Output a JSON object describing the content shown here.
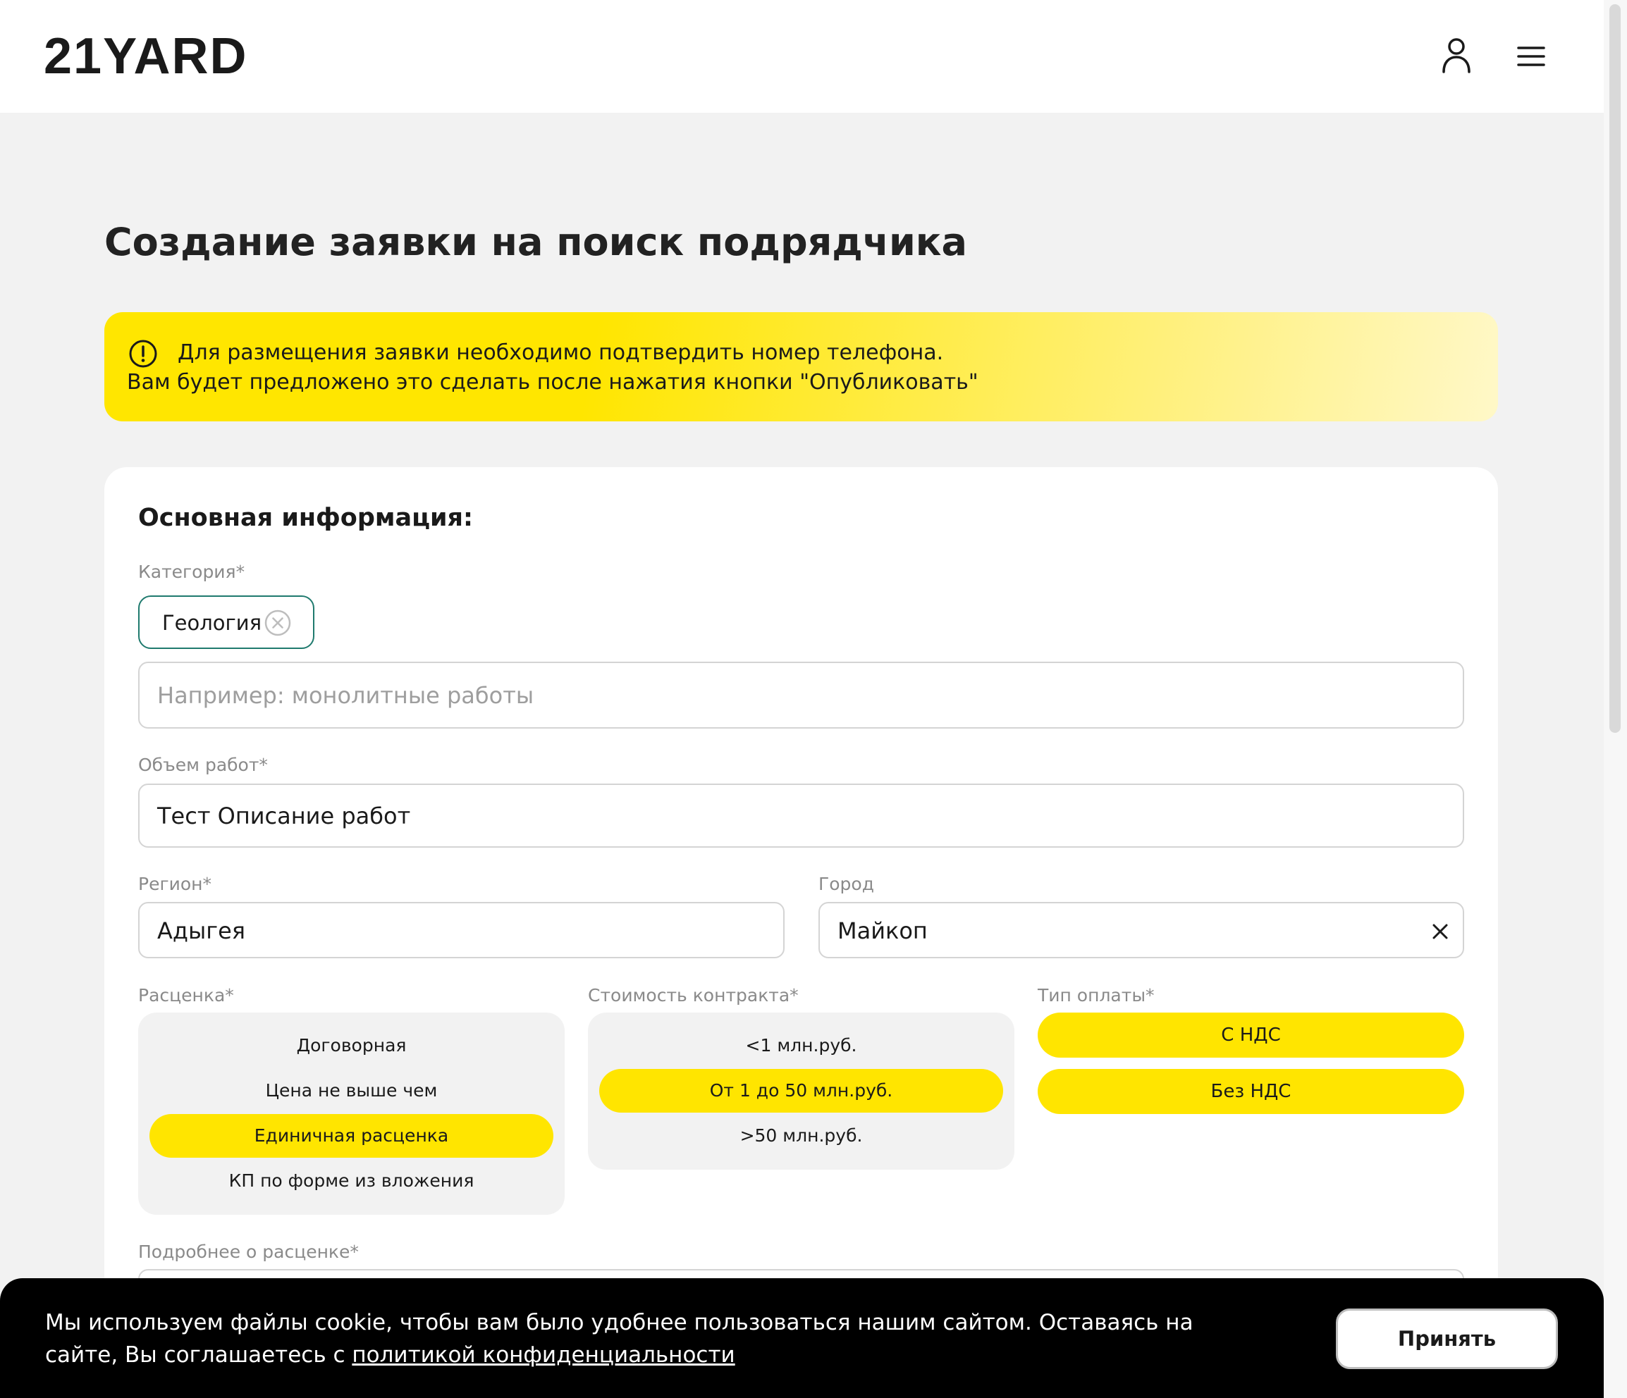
{
  "header": {
    "logo": "21YARD",
    "user_icon": "user-icon",
    "menu_icon": "hamburger-menu-icon"
  },
  "page": {
    "title": "Создание заявки на поиск подрядчика"
  },
  "notice": {
    "icon": "exclamation-circle-icon",
    "line1": "Для размещения заявки необходимо подтвердить номер телефона.",
    "line2": "Вам будет предложено это сделать после нажатия кнопки \"Опубликовать\""
  },
  "form": {
    "section_title": "Основная информация:",
    "category": {
      "label": "Категория*",
      "chip": "Геология",
      "placeholder": "Например: монолитные работы"
    },
    "volume": {
      "label": "Объем работ*",
      "value": "Тест Описание работ"
    },
    "region": {
      "label": "Регион*",
      "value": "Адыгея"
    },
    "city": {
      "label": "Город",
      "value": "Майкоп"
    },
    "pricing": {
      "label": "Расценка*",
      "options": [
        "Договорная",
        "Цена не выше чем",
        "Единичная расценка",
        "КП по форме из вложения"
      ],
      "selected": "Единичная расценка"
    },
    "contract_cost": {
      "label": "Стоимость контракта*",
      "options": [
        "<1 млн.руб.",
        "От 1 до 50 млн.руб.",
        ">50 млн.руб."
      ],
      "selected": "От 1 до 50 млн.руб."
    },
    "payment_type": {
      "label": "Тип оплаты*",
      "options": [
        "С НДС",
        "Без НДС"
      ]
    },
    "pricing_details": {
      "label": "Подробнее о расценке*"
    }
  },
  "cookie": {
    "text": "Мы используем файлы cookie, чтобы вам было удобнее пользоваться нашим сайтом. Оставаясь на сайте, Вы соглашаетесь с ",
    "link": "политикой конфиденциальности",
    "accept": "Принять"
  },
  "colors": {
    "accent_yellow": "#ffe500",
    "chip_border": "#1f7a6e",
    "cookie_bg": "#000000"
  }
}
